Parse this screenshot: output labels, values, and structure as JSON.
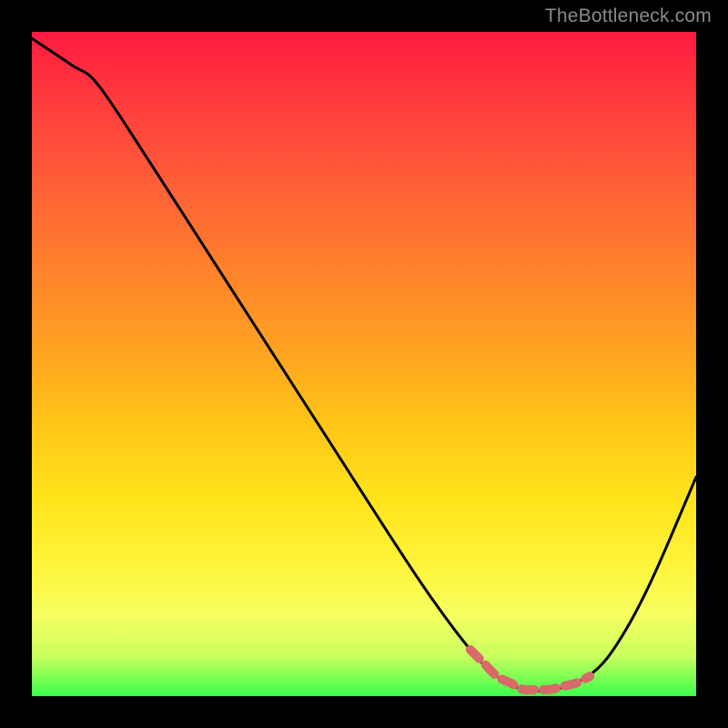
{
  "watermark": "TheBottleneck.com",
  "colors": {
    "curve_stroke": "#000000",
    "highlight_stroke": "#d86a6a",
    "background": "#000000"
  },
  "chart_data": {
    "type": "line",
    "title": "",
    "xlabel": "",
    "ylabel": "",
    "xlim": [
      0,
      100
    ],
    "ylim": [
      0,
      100
    ],
    "series": [
      {
        "name": "bottleneck-curve",
        "x": [
          0,
          6,
          10,
          18,
          27,
          36,
          45,
          54,
          60,
          66,
          70,
          74,
          78,
          82,
          86,
          90,
          94,
          100
        ],
        "values": [
          99,
          95,
          92,
          80,
          66,
          52,
          38,
          24,
          15,
          7,
          3,
          1,
          1,
          2,
          5,
          11,
          19,
          33
        ]
      },
      {
        "name": "sweet-spot-highlight",
        "x": [
          66,
          68,
          70,
          72,
          74,
          76,
          78,
          80,
          82,
          84
        ],
        "values": [
          7,
          5,
          3,
          2,
          1,
          1,
          1,
          1.5,
          2,
          3
        ]
      }
    ],
    "annotations": []
  }
}
